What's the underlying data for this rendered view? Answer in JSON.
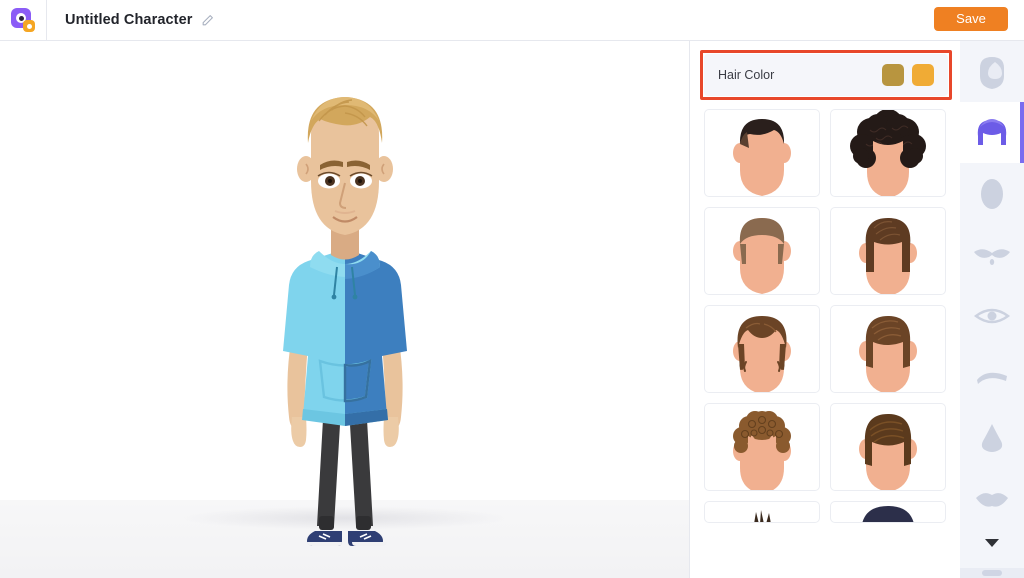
{
  "header": {
    "logo_icon": "app-logo-icon",
    "title": "Untitled Character",
    "edit_icon": "pencil-icon",
    "save_label": "Save"
  },
  "stage": {
    "name": "character-preview",
    "character": {
      "hair_color": "#d2a75c",
      "skin_color": "#e8c09a",
      "hoodie_left_color": "#7fd4ed",
      "hoodie_right_color": "#3d7fbf",
      "pants_color": "#3a3a3c",
      "shoes_color": "#2f3f74"
    }
  },
  "options_panel": {
    "annotation_highlight_color": "#e8472a",
    "color_section": {
      "label": "Hair Color",
      "swatches": [
        {
          "name": "hair-color-swatch-1",
          "color": "#b8953f",
          "selected": true
        },
        {
          "name": "hair-color-swatch-2",
          "color": "#f0ab35",
          "selected": false
        }
      ]
    },
    "thumbnails": [
      {
        "id": 1,
        "name": "hairstyle-thumbnail-1",
        "style": "short-crop",
        "hair_color": "#2a1f1c"
      },
      {
        "id": 2,
        "name": "hairstyle-thumbnail-2",
        "style": "afro-curly",
        "hair_color": "#241a17"
      },
      {
        "id": 3,
        "name": "hairstyle-thumbnail-3",
        "style": "receding-short",
        "hair_color": "#8a6a4f"
      },
      {
        "id": 4,
        "name": "hairstyle-thumbnail-4",
        "style": "straight-fringe",
        "hair_color": "#5e3b22"
      },
      {
        "id": 5,
        "name": "hairstyle-thumbnail-5",
        "style": "messy-wavy",
        "hair_color": "#6b4426"
      },
      {
        "id": 6,
        "name": "hairstyle-thumbnail-6",
        "style": "side-swept",
        "hair_color": "#6b4426"
      },
      {
        "id": 7,
        "name": "hairstyle-thumbnail-7",
        "style": "tight-curls",
        "hair_color": "#8a5a2e"
      },
      {
        "id": 8,
        "name": "hairstyle-thumbnail-8",
        "style": "combed-over",
        "hair_color": "#5b3a1d"
      },
      {
        "id": 9,
        "name": "hairstyle-thumbnail-9",
        "style": "spiky-partial",
        "hair_color": "#3a2a1e"
      },
      {
        "id": 10,
        "name": "hairstyle-thumbnail-10",
        "style": "dark-round",
        "hair_color": "#2c2f4a"
      }
    ]
  },
  "rail": {
    "active_color": "#7a6cf0",
    "inactive_color": "#c9cfdd",
    "items": [
      {
        "name": "rail-item-face-shape",
        "icon": "face-shape-icon",
        "active": false
      },
      {
        "name": "rail-item-hair",
        "icon": "hair-icon",
        "active": true
      },
      {
        "name": "rail-item-head",
        "icon": "head-icon",
        "active": false
      },
      {
        "name": "rail-item-mustache",
        "icon": "mustache-icon",
        "active": false
      },
      {
        "name": "rail-item-eyes",
        "icon": "eye-icon",
        "active": false
      },
      {
        "name": "rail-item-eyebrows",
        "icon": "eyebrow-icon",
        "active": false
      },
      {
        "name": "rail-item-nose",
        "icon": "nose-icon",
        "active": false
      },
      {
        "name": "rail-item-mouth",
        "icon": "mouth-icon",
        "active": false
      }
    ],
    "scroll_icon": "chevron-down-icon"
  }
}
